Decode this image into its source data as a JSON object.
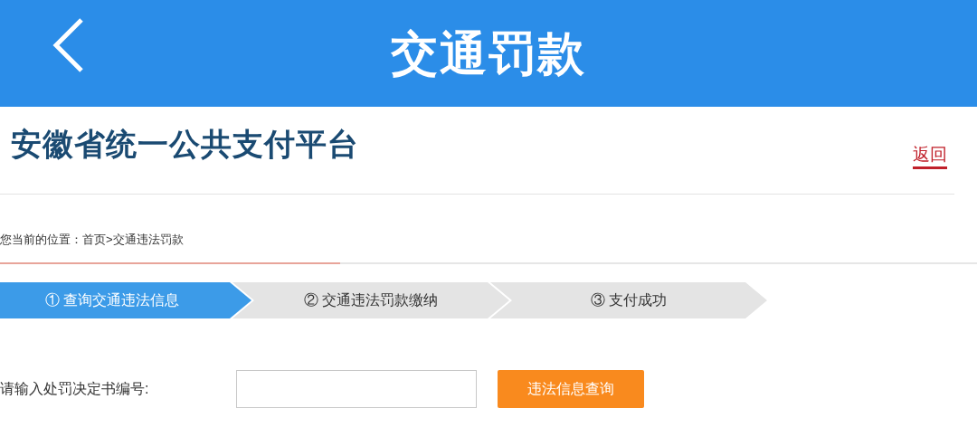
{
  "header": {
    "title": "交通罚款"
  },
  "brand": {
    "logo_text": "安徽省统一公共支付平台",
    "back_link": "返回"
  },
  "breadcrumb": "您当前的位置：首页>交通违法罚款",
  "steps": [
    {
      "label": "① 查询交通违法信息",
      "selected": true
    },
    {
      "label": "② 交通违法罚款缴纳",
      "selected": false
    },
    {
      "label": "③ 支付成功",
      "selected": false
    }
  ],
  "form": {
    "label": "请输入处罚决定书编号:",
    "button": "违法信息查询"
  }
}
